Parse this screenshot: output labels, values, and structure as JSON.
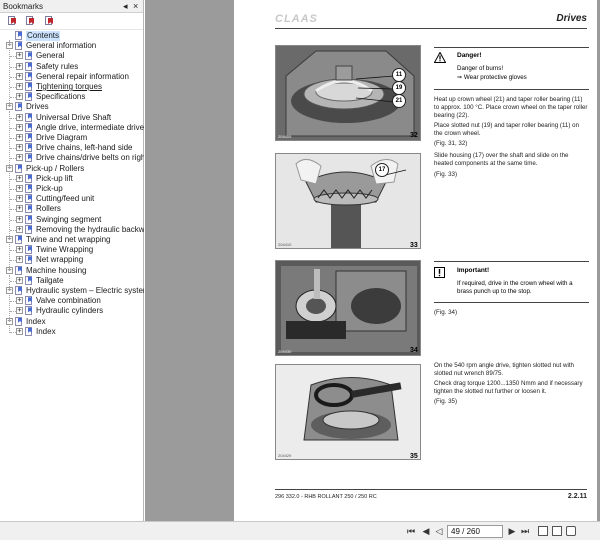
{
  "sidebar": {
    "title": "Bookmarks",
    "close_glyph": "×",
    "menu_glyph": "◂",
    "tools": [
      "new-bookmark-icon",
      "expand-bookmark-icon",
      "bookmark-options-icon"
    ],
    "items": [
      {
        "label": "Contents",
        "level": 0,
        "toggle": "",
        "selected": true
      },
      {
        "label": "General information",
        "level": 0,
        "toggle": "−"
      },
      {
        "label": "General",
        "level": 1,
        "toggle": "+"
      },
      {
        "label": "Safety rules",
        "level": 1,
        "toggle": "+"
      },
      {
        "label": "General repair information",
        "level": 1,
        "toggle": "+"
      },
      {
        "label": "Tightening torques",
        "level": 1,
        "toggle": "+",
        "underline": true
      },
      {
        "label": "Specifications",
        "level": 1,
        "toggle": "+"
      },
      {
        "label": "Drives",
        "level": 0,
        "toggle": "−"
      },
      {
        "label": "Universal Drive Shaft",
        "level": 1,
        "toggle": "+"
      },
      {
        "label": "Angle drive, intermediate drive",
        "level": 1,
        "toggle": "+"
      },
      {
        "label": "Drive Diagram",
        "level": 1,
        "toggle": "+"
      },
      {
        "label": "Drive chains, left-hand side",
        "level": 1,
        "toggle": "+"
      },
      {
        "label": "Drive chains/drive belts on right-ha",
        "level": 1,
        "toggle": "+"
      },
      {
        "label": "Pick-up / Rollers",
        "level": 0,
        "toggle": "−"
      },
      {
        "label": "Pick-up lift",
        "level": 1,
        "toggle": "+"
      },
      {
        "label": "Pick-up",
        "level": 1,
        "toggle": "+"
      },
      {
        "label": "Cutting/feed unit",
        "level": 1,
        "toggle": "+"
      },
      {
        "label": "Rollers",
        "level": 1,
        "toggle": "+"
      },
      {
        "label": "Swinging segment",
        "level": 1,
        "toggle": "+"
      },
      {
        "label": "Removing the hydraulic backwinde",
        "level": 1,
        "toggle": "+"
      },
      {
        "label": "Twine and net wrapping",
        "level": 0,
        "toggle": "−"
      },
      {
        "label": "Twine Wrapping",
        "level": 1,
        "toggle": "+"
      },
      {
        "label": "Net wrapping",
        "level": 1,
        "toggle": "+"
      },
      {
        "label": "Machine housing",
        "level": 0,
        "toggle": "−"
      },
      {
        "label": "Tailgate",
        "level": 1,
        "toggle": "+"
      },
      {
        "label": "Hydraulic system – Electric system",
        "level": 0,
        "toggle": "−"
      },
      {
        "label": "Valve combination",
        "level": 1,
        "toggle": "+"
      },
      {
        "label": "Hydraulic cylinders",
        "level": 1,
        "toggle": "+"
      },
      {
        "label": "Index",
        "level": 0,
        "toggle": "−"
      },
      {
        "label": "Index",
        "level": 1,
        "toggle": "+"
      }
    ]
  },
  "page": {
    "logo": "CLAAS",
    "section_title": "Drives",
    "figures": [
      {
        "num": "32",
        "code": "204409",
        "callouts": [
          "11",
          "19",
          "21"
        ]
      },
      {
        "num": "33",
        "code": "204410",
        "callouts": [
          "17"
        ]
      },
      {
        "num": "34",
        "code": "204430",
        "callouts": []
      },
      {
        "num": "35",
        "code": "204429",
        "callouts": []
      }
    ],
    "danger": {
      "title": "Danger!",
      "line1": "Danger of burns!",
      "line2": "⇒ Wear protective gloves"
    },
    "block1": [
      "Heat up crown wheel (21) and taper roller bearing (11) to approx. 100 °C. Place crown wheel on the taper roller bearing (22).",
      "Place slotted nut (19) and taper roller bearing (11) on the crown wheel.",
      "(Fig. 31, 32)",
      "Slide housing (17) over the shaft and slide on the heated components at the same time.",
      "(Fig. 33)"
    ],
    "important": {
      "title": "Important!",
      "body": "If required, drive in the crown wheel with a brass punch up to the stop."
    },
    "fig34_ref": "(Fig. 34)",
    "block2": [
      "On the 540 rpm angle drive, tighten slotted nut with slotted nut wrench 89/75.",
      "Check drag torque 1200...1350 Nmm and if necessary tighten the slotted nut further or loosen it.",
      "(Fig. 35)"
    ],
    "footer_left": "296 332.0 - RHB ROLLANT 250 / 250 RC",
    "footer_right": "2.2.11"
  },
  "toolbar": {
    "page_field": "49 / 260",
    "first_glyph": "⏮",
    "prev_glyph": "◀",
    "next_glyph": "▶",
    "last_glyph": "⏭"
  }
}
